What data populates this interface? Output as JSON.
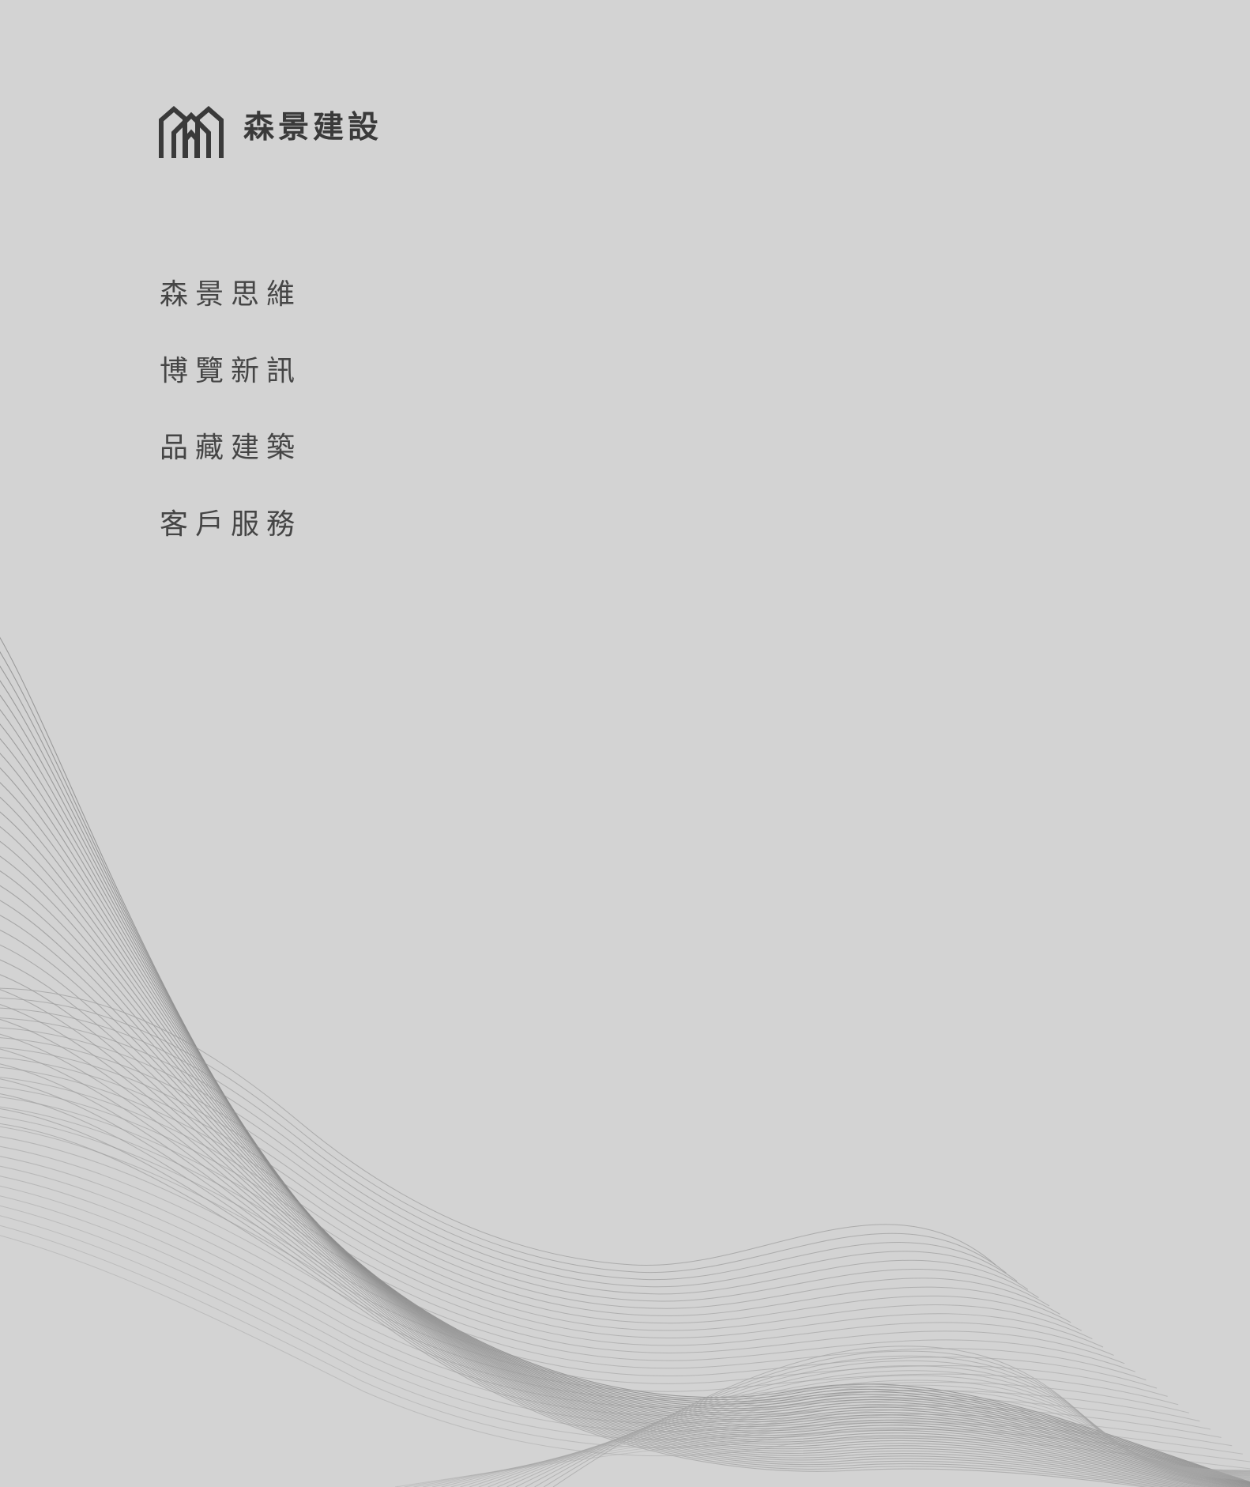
{
  "brand": {
    "name": "森景建設",
    "logo_icon": "building-m-logo-icon",
    "logo_color": "#3a3a3a"
  },
  "menu": {
    "items": [
      {
        "label": "森景思維"
      },
      {
        "label": "博覽新訊"
      },
      {
        "label": "品藏建築"
      },
      {
        "label": "客戶服務"
      }
    ]
  },
  "theme": {
    "background": "#d3d3d3",
    "text": "#454545",
    "wave_stroke": "#8e8e8e"
  }
}
